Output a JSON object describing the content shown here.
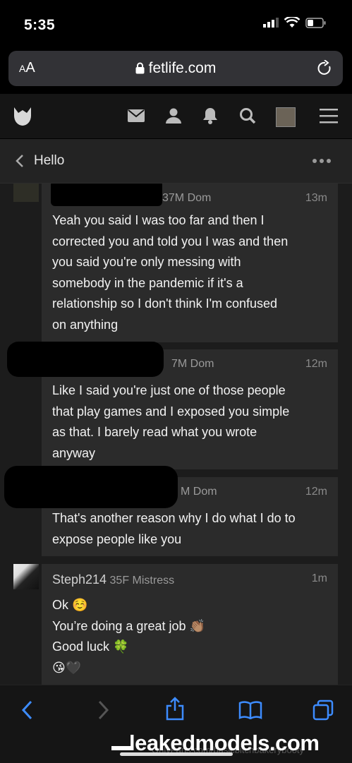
{
  "status_bar": {
    "time": "5:35"
  },
  "browser": {
    "text_size_label_small": "A",
    "text_size_label_large": "A",
    "url": "fetlife.com"
  },
  "app_nav": {
    "icons": [
      "fetlife-logo-icon",
      "mail-icon",
      "person-icon",
      "bell-icon",
      "search-icon",
      "avatar",
      "menu-icon"
    ]
  },
  "thread": {
    "back_label": "<",
    "title": "Hello"
  },
  "messages": [
    {
      "sender_visible": "37M Dom",
      "time": "13m",
      "lines": [
        "Yeah you said I was too far and then I",
        "corrected you and told you I was and then",
        "you said you're only messing with",
        "somebody in the pandemic if it's a",
        "relationship so I don't think I'm confused",
        "on anything"
      ]
    },
    {
      "sender_visible": "7M Dom",
      "time": "12m",
      "lines": [
        "Like I said you're just one of those people",
        "that play games and I exposed you simple",
        "as that. I barely read what you wrote",
        "anyway"
      ]
    },
    {
      "sender_visible": "M Dom",
      "time": "12m",
      "lines": [
        "That's another reason why I do what I do to",
        "expose people like you"
      ]
    },
    {
      "sender_name": "Steph214",
      "sender_meta": "35F Mistress",
      "time": "1m",
      "lines": [
        "Ok ☺️",
        "You’re doing a great job 👏🏽",
        "Good luck 🍀",
        "😘🖤"
      ]
    }
  ],
  "toolbar": {
    "icons": [
      "back-icon",
      "forward-icon",
      "share-icon",
      "bookmarks-icon",
      "tabs-icon"
    ]
  },
  "watermark": {
    "text": "leakedmodels.com",
    "faint_text": "OnlyFans.com/basicbitchbakerybooty"
  }
}
